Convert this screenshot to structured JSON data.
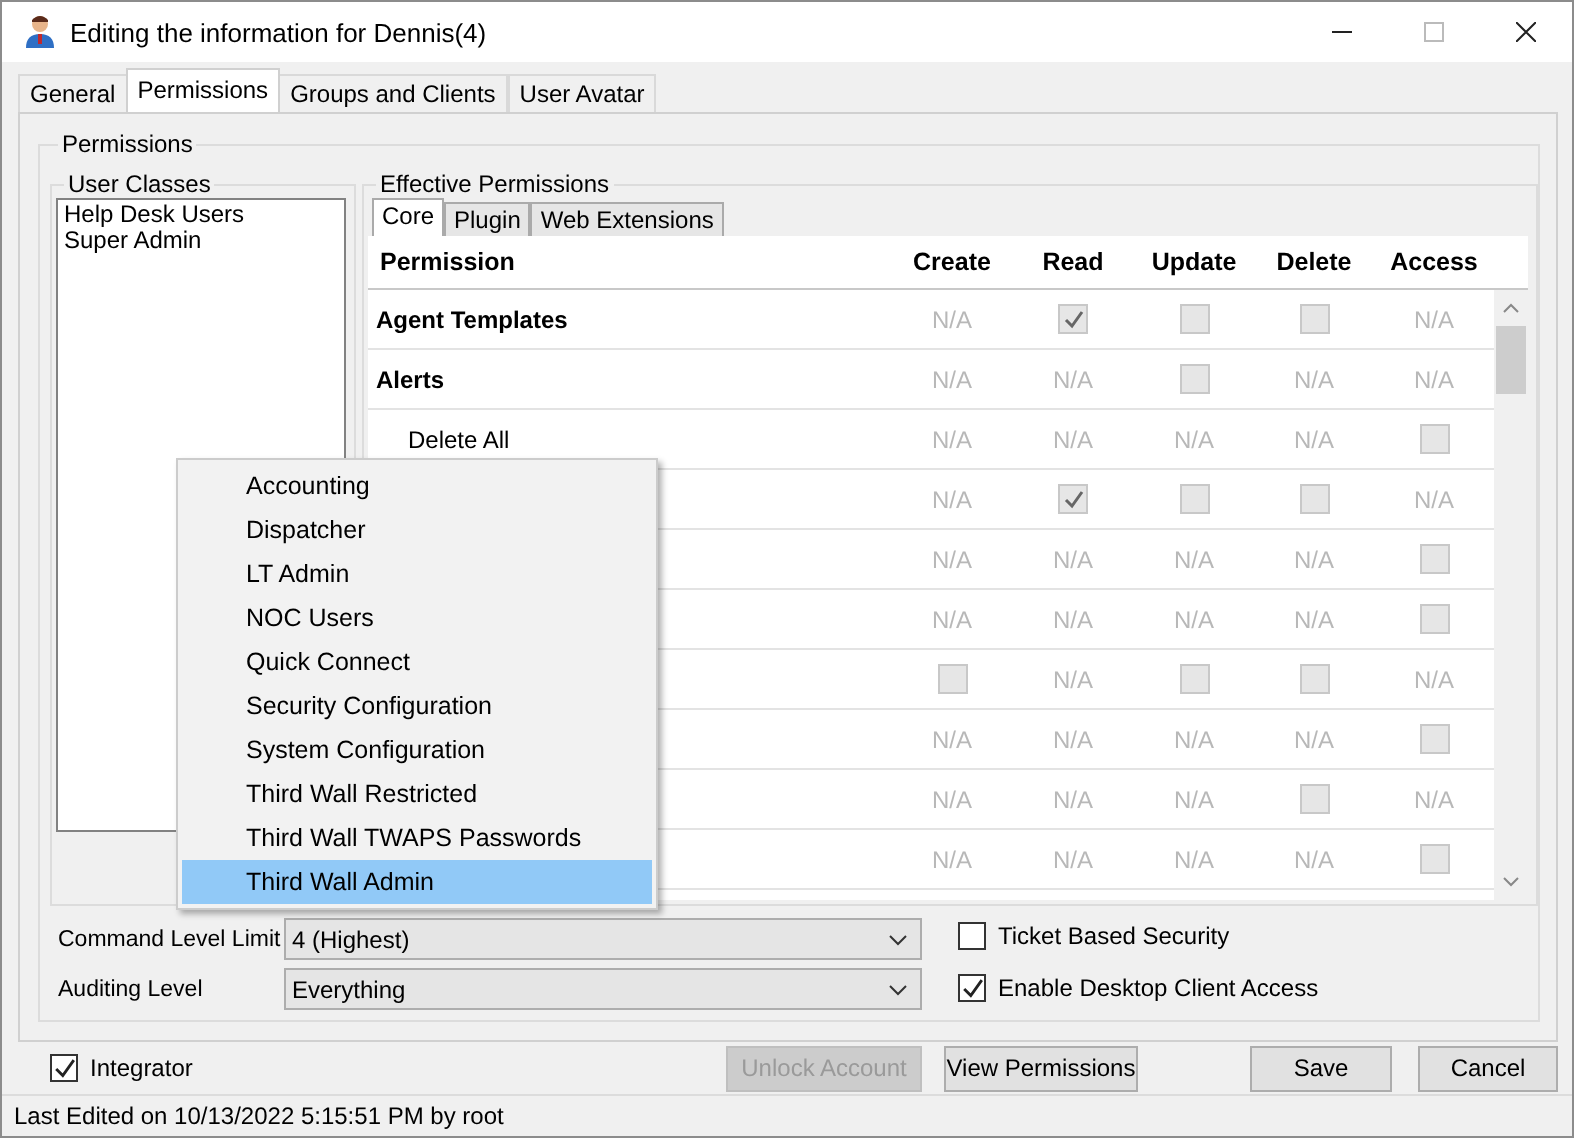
{
  "window": {
    "title": "Editing the information for Dennis(4)"
  },
  "tabs": [
    {
      "label": "General",
      "selected": false
    },
    {
      "label": "Permissions",
      "selected": true
    },
    {
      "label": "Groups and Clients",
      "selected": false
    },
    {
      "label": "User Avatar",
      "selected": false
    }
  ],
  "permissions_group": {
    "title": "Permissions"
  },
  "user_classes": {
    "title": "User Classes",
    "items": [
      "Help Desk Users",
      "Super Admin"
    ]
  },
  "effective_permissions": {
    "title": "Effective Permissions",
    "tabs": [
      {
        "label": "Core",
        "selected": true
      },
      {
        "label": "Plugin",
        "selected": false
      },
      {
        "label": "Web Extensions",
        "selected": false
      }
    ],
    "columns": [
      "Permission",
      "Create",
      "Read",
      "Update",
      "Delete",
      "Access"
    ],
    "rows": [
      {
        "cells": [
          {
            "kind": "category",
            "text": "Agent Templates"
          },
          {
            "kind": "na",
            "text": "N/A"
          },
          {
            "kind": "check",
            "checked": true
          },
          {
            "kind": "check",
            "checked": false
          },
          {
            "kind": "check",
            "checked": false
          },
          {
            "kind": "na",
            "text": "N/A"
          }
        ]
      },
      {
        "cells": [
          {
            "kind": "category",
            "text": "Alerts"
          },
          {
            "kind": "na",
            "text": "N/A"
          },
          {
            "kind": "na",
            "text": "N/A"
          },
          {
            "kind": "check",
            "checked": false
          },
          {
            "kind": "na",
            "text": "N/A"
          },
          {
            "kind": "na",
            "text": "N/A"
          }
        ]
      },
      {
        "cells": [
          {
            "kind": "item",
            "text": "Delete All"
          },
          {
            "kind": "na",
            "text": "N/A"
          },
          {
            "kind": "na",
            "text": "N/A"
          },
          {
            "kind": "na",
            "text": "N/A"
          },
          {
            "kind": "na",
            "text": "N/A"
          },
          {
            "kind": "check",
            "checked": false
          }
        ]
      },
      {
        "cells": [
          {
            "kind": "covered"
          },
          {
            "kind": "na",
            "text": "N/A"
          },
          {
            "kind": "check",
            "checked": true
          },
          {
            "kind": "check",
            "checked": false
          },
          {
            "kind": "check",
            "checked": false
          },
          {
            "kind": "na",
            "text": "N/A"
          }
        ]
      },
      {
        "cells": [
          {
            "kind": "covered"
          },
          {
            "kind": "na",
            "text": "N/A"
          },
          {
            "kind": "na",
            "text": "N/A"
          },
          {
            "kind": "na",
            "text": "N/A"
          },
          {
            "kind": "na",
            "text": "N/A"
          },
          {
            "kind": "check",
            "checked": false
          }
        ]
      },
      {
        "cells": [
          {
            "kind": "covered"
          },
          {
            "kind": "na",
            "text": "N/A"
          },
          {
            "kind": "na",
            "text": "N/A"
          },
          {
            "kind": "na",
            "text": "N/A"
          },
          {
            "kind": "na",
            "text": "N/A"
          },
          {
            "kind": "check",
            "checked": false
          }
        ]
      },
      {
        "cells": [
          {
            "kind": "covered"
          },
          {
            "kind": "check",
            "checked": false
          },
          {
            "kind": "na",
            "text": "N/A"
          },
          {
            "kind": "check",
            "checked": false
          },
          {
            "kind": "check",
            "checked": false
          },
          {
            "kind": "na",
            "text": "N/A"
          }
        ]
      },
      {
        "cells": [
          {
            "kind": "covered"
          },
          {
            "kind": "na",
            "text": "N/A"
          },
          {
            "kind": "na",
            "text": "N/A"
          },
          {
            "kind": "na",
            "text": "N/A"
          },
          {
            "kind": "na",
            "text": "N/A"
          },
          {
            "kind": "check",
            "checked": false
          }
        ]
      },
      {
        "cells": [
          {
            "kind": "covered"
          },
          {
            "kind": "na",
            "text": "N/A"
          },
          {
            "kind": "na",
            "text": "N/A"
          },
          {
            "kind": "na",
            "text": "N/A"
          },
          {
            "kind": "check",
            "checked": false
          },
          {
            "kind": "na",
            "text": "N/A"
          }
        ]
      },
      {
        "cells": [
          {
            "kind": "covered"
          },
          {
            "kind": "na",
            "text": "N/A"
          },
          {
            "kind": "na",
            "text": "N/A"
          },
          {
            "kind": "na",
            "text": "N/A"
          },
          {
            "kind": "na",
            "text": "N/A"
          },
          {
            "kind": "check",
            "checked": false
          }
        ]
      }
    ]
  },
  "settings": [
    {
      "label": "Command Level Limit",
      "value": "4 (Highest)"
    },
    {
      "label": "Auditing Level",
      "value": "Everything"
    }
  ],
  "options": [
    {
      "label": "Ticket Based Security",
      "checked": false
    },
    {
      "label": "Enable Desktop Client Access",
      "checked": true
    }
  ],
  "integrator": {
    "label": "Integrator",
    "checked": true
  },
  "buttons": [
    {
      "label": "Unlock Account",
      "disabled": true
    },
    {
      "label": "View Permissions",
      "disabled": false
    },
    {
      "label": "Save",
      "disabled": false
    },
    {
      "label": "Cancel",
      "disabled": false
    }
  ],
  "context_menu": {
    "items": [
      {
        "label": "Accounting",
        "selected": false
      },
      {
        "label": "Dispatcher",
        "selected": false
      },
      {
        "label": "LT Admin",
        "selected": false
      },
      {
        "label": "NOC Users",
        "selected": false
      },
      {
        "label": "Quick Connect",
        "selected": false
      },
      {
        "label": "Security Configuration",
        "selected": false
      },
      {
        "label": "System Configuration",
        "selected": false
      },
      {
        "label": "Third Wall Restricted",
        "selected": false
      },
      {
        "label": "Third Wall TWAPS Passwords",
        "selected": false
      },
      {
        "label": "Third Wall Admin",
        "selected": true
      }
    ]
  },
  "status_bar": "Last Edited on 10/13/2022 5:15:51 PM by root"
}
